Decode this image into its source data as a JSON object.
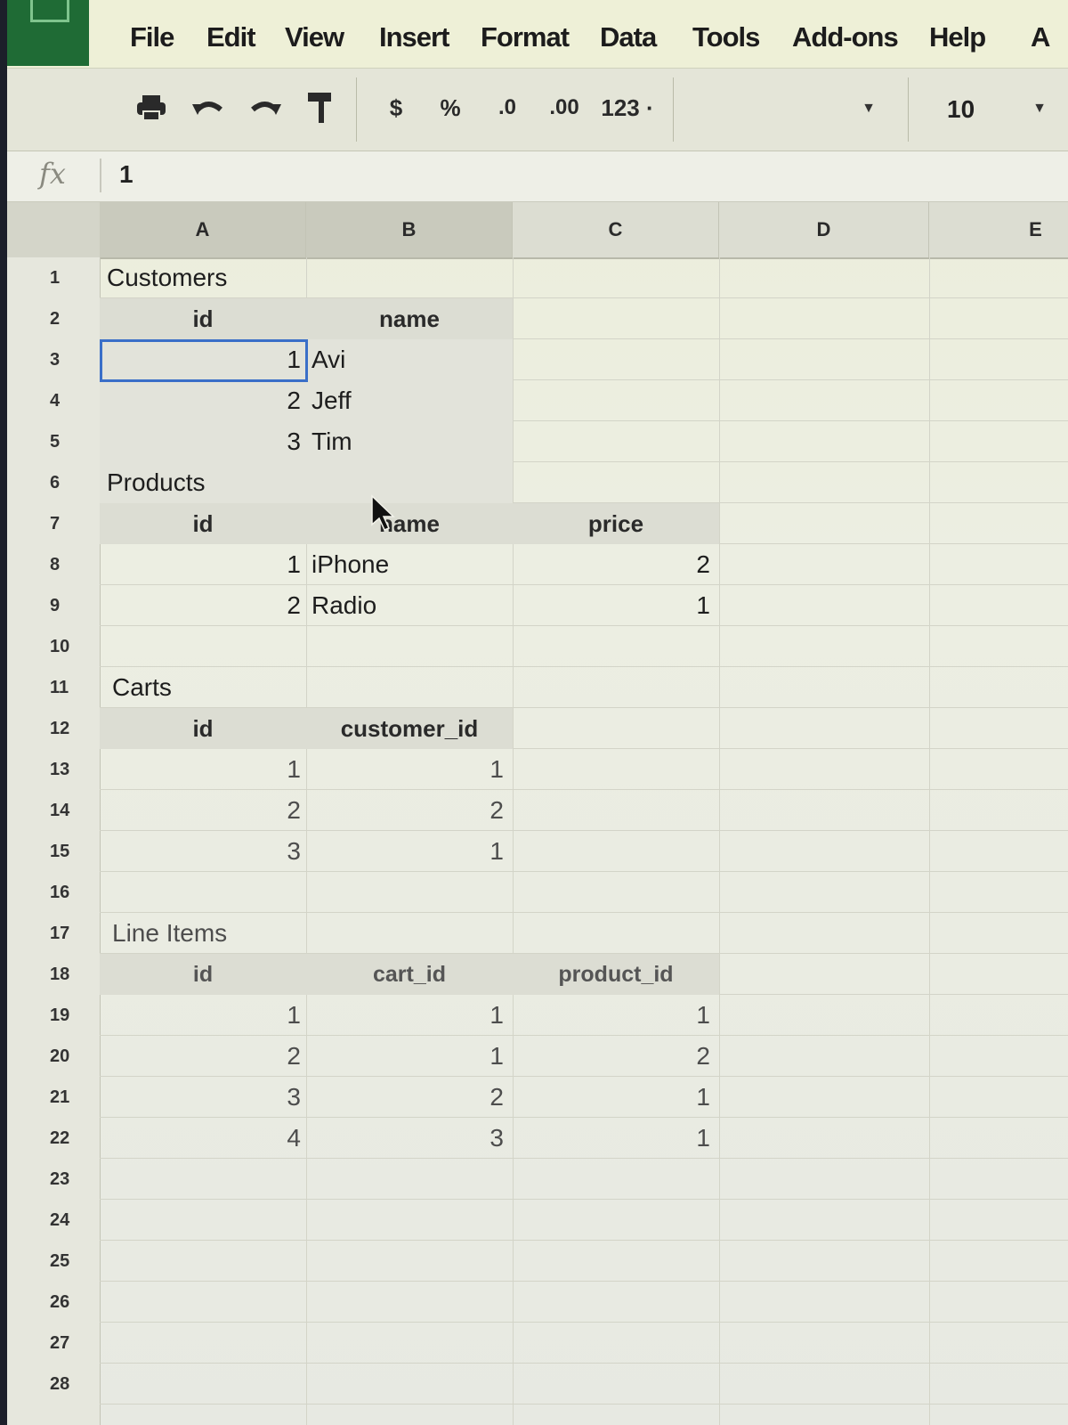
{
  "menu": {
    "items": [
      "File",
      "Edit",
      "View",
      "Insert",
      "Format",
      "Data",
      "Tools",
      "Add-ons",
      "Help",
      "A"
    ]
  },
  "toolbar": {
    "print_icon": "print-icon",
    "undo_icon": "undo-icon",
    "redo_icon": "redo-icon",
    "paint_format_icon": "paint-format-icon",
    "currency_label": "$",
    "percent_label": "%",
    "decrease_decimal_label": ".0",
    "increase_decimal_label": ".00",
    "more_formats_label": "123 ·",
    "font_name": "",
    "font_size": "10"
  },
  "formula_bar": {
    "fx_label": "fx",
    "value": "1"
  },
  "grid": {
    "columns": [
      "A",
      "B",
      "C",
      "D",
      "E"
    ],
    "rows": [
      "1",
      "2",
      "3",
      "4",
      "5",
      "6",
      "7",
      "8",
      "9",
      "10",
      "11",
      "12",
      "13",
      "14",
      "15",
      "16",
      "17",
      "18",
      "19",
      "20",
      "21",
      "22",
      "23",
      "24",
      "25",
      "26",
      "27",
      "28"
    ]
  },
  "sheet": {
    "customers": {
      "title": "Customers",
      "headers": [
        "id",
        "name"
      ],
      "rows": [
        [
          "1",
          "Avi"
        ],
        [
          "2",
          "Jeff"
        ],
        [
          "3",
          "Tim"
        ]
      ]
    },
    "products": {
      "title": "Products",
      "headers": [
        "id",
        "name",
        "price"
      ],
      "rows": [
        [
          "1",
          "iPhone",
          "2"
        ],
        [
          "2",
          "Radio",
          "1"
        ]
      ]
    },
    "carts": {
      "title": "Carts",
      "headers": [
        "id",
        "customer_id"
      ],
      "rows": [
        [
          "1",
          "1"
        ],
        [
          "2",
          "2"
        ],
        [
          "3",
          "1"
        ]
      ]
    },
    "line_items": {
      "title": "Line Items",
      "headers": [
        "id",
        "cart_id",
        "product_id"
      ],
      "rows": [
        [
          "1",
          "1",
          "1"
        ],
        [
          "2",
          "1",
          "2"
        ],
        [
          "3",
          "2",
          "1"
        ],
        [
          "4",
          "3",
          "1"
        ]
      ]
    }
  },
  "colors": {
    "menu_bg": "#eef0d7",
    "logo": "#1f6b35",
    "selection_border": "#3a6fc8",
    "header_fill": "#dcddd3"
  }
}
